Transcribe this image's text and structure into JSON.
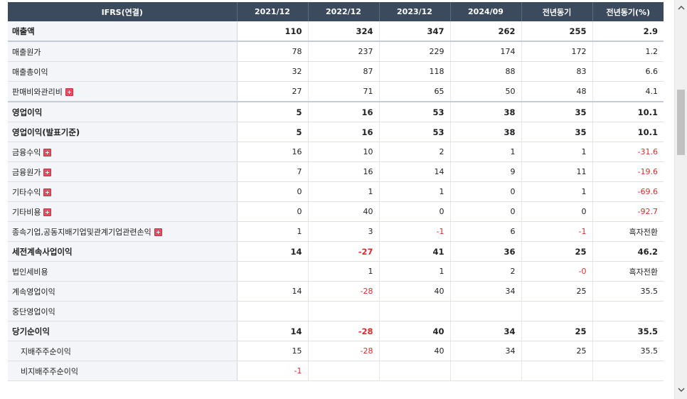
{
  "header": {
    "label_col": "IFRS(연결)",
    "periods": [
      "2021/12",
      "2022/12",
      "2023/12",
      "2024/09",
      "전년동기",
      "전년동기(%)"
    ]
  },
  "rows": [
    {
      "label": "매출액",
      "values": [
        "110",
        "324",
        "347",
        "262",
        "255",
        "2.9"
      ],
      "neg": [
        false,
        false,
        false,
        false,
        false,
        false
      ],
      "bold": true,
      "expand": false,
      "indent": false,
      "strong_line": true
    },
    {
      "label": "매출원가",
      "values": [
        "78",
        "237",
        "229",
        "174",
        "172",
        "1.2"
      ],
      "neg": [
        false,
        false,
        false,
        false,
        false,
        false
      ],
      "bold": false,
      "expand": false,
      "indent": false
    },
    {
      "label": "매출총이익",
      "values": [
        "32",
        "87",
        "118",
        "88",
        "83",
        "6.6"
      ],
      "neg": [
        false,
        false,
        false,
        false,
        false,
        false
      ],
      "bold": false,
      "expand": false,
      "indent": false
    },
    {
      "label": "판매비와관리비",
      "values": [
        "27",
        "71",
        "65",
        "50",
        "48",
        "4.1"
      ],
      "neg": [
        false,
        false,
        false,
        false,
        false,
        false
      ],
      "bold": false,
      "expand": true,
      "indent": false,
      "strong_line": true
    },
    {
      "label": "영업이익",
      "values": [
        "5",
        "16",
        "53",
        "38",
        "35",
        "10.1"
      ],
      "neg": [
        false,
        false,
        false,
        false,
        false,
        false
      ],
      "bold": true,
      "expand": false,
      "indent": false
    },
    {
      "label": "영업이익(발표기준)",
      "values": [
        "5",
        "16",
        "53",
        "38",
        "35",
        "10.1"
      ],
      "neg": [
        false,
        false,
        false,
        false,
        false,
        false
      ],
      "bold": true,
      "expand": false,
      "indent": false
    },
    {
      "label": "금융수익",
      "values": [
        "16",
        "10",
        "2",
        "1",
        "1",
        "-31.6"
      ],
      "neg": [
        false,
        false,
        false,
        false,
        false,
        true
      ],
      "bold": false,
      "expand": true,
      "indent": false
    },
    {
      "label": "금융원가",
      "values": [
        "7",
        "16",
        "14",
        "9",
        "11",
        "-19.6"
      ],
      "neg": [
        false,
        false,
        false,
        false,
        false,
        true
      ],
      "bold": false,
      "expand": true,
      "indent": false
    },
    {
      "label": "기타수익",
      "values": [
        "0",
        "1",
        "1",
        "0",
        "1",
        "-69.6"
      ],
      "neg": [
        false,
        false,
        false,
        false,
        false,
        true
      ],
      "bold": false,
      "expand": true,
      "indent": false
    },
    {
      "label": "기타비용",
      "values": [
        "0",
        "40",
        "0",
        "0",
        "0",
        "-92.7"
      ],
      "neg": [
        false,
        false,
        false,
        false,
        false,
        true
      ],
      "bold": false,
      "expand": true,
      "indent": false
    },
    {
      "label": "종속기업,공동지배기업및관계기업관련손익",
      "values": [
        "1",
        "3",
        "-1",
        "6",
        "-1",
        "흑자전환"
      ],
      "neg": [
        false,
        false,
        true,
        false,
        true,
        false
      ],
      "bold": false,
      "expand": true,
      "indent": false
    },
    {
      "label": "세전계속사업이익",
      "values": [
        "14",
        "-27",
        "41",
        "36",
        "25",
        "46.2"
      ],
      "neg": [
        false,
        true,
        false,
        false,
        false,
        false
      ],
      "bold": true,
      "expand": false,
      "indent": false
    },
    {
      "label": "법인세비용",
      "values": [
        "",
        "1",
        "1",
        "2",
        "-0",
        "흑자전환"
      ],
      "neg": [
        false,
        false,
        false,
        false,
        true,
        false
      ],
      "bold": false,
      "expand": false,
      "indent": false
    },
    {
      "label": "계속영업이익",
      "values": [
        "14",
        "-28",
        "40",
        "34",
        "25",
        "35.5"
      ],
      "neg": [
        false,
        true,
        false,
        false,
        false,
        false
      ],
      "bold": false,
      "expand": false,
      "indent": false
    },
    {
      "label": "중단영업이익",
      "values": [
        "",
        "",
        "",
        "",
        "",
        ""
      ],
      "neg": [
        false,
        false,
        false,
        false,
        false,
        false
      ],
      "bold": false,
      "expand": false,
      "indent": false
    },
    {
      "label": "당기순이익",
      "values": [
        "14",
        "-28",
        "40",
        "34",
        "25",
        "35.5"
      ],
      "neg": [
        false,
        true,
        false,
        false,
        false,
        false
      ],
      "bold": true,
      "expand": false,
      "indent": false
    },
    {
      "label": "지배주주순이익",
      "values": [
        "15",
        "-28",
        "40",
        "34",
        "25",
        "35.5"
      ],
      "neg": [
        false,
        true,
        false,
        false,
        false,
        false
      ],
      "bold": false,
      "expand": false,
      "indent": true
    },
    {
      "label": "비지배주주순이익",
      "values": [
        "-1",
        "",
        "",
        "",
        "",
        ""
      ],
      "neg": [
        true,
        false,
        false,
        false,
        false,
        false
      ],
      "bold": false,
      "expand": false,
      "indent": true
    }
  ],
  "scrollbar": {
    "up_icon": "chevron-up-icon",
    "down_icon": "chevron-down-icon"
  }
}
